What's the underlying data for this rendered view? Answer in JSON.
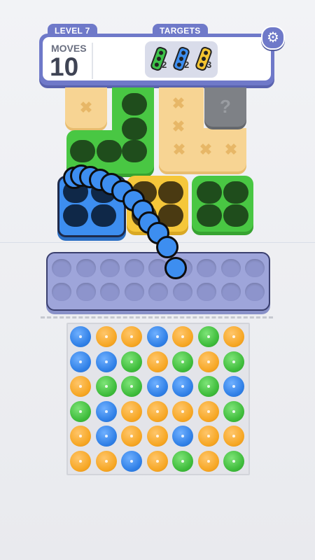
{
  "header": {
    "level": "LEVEL 7",
    "targets_label": "TARGETS",
    "moves_label": "MOVES",
    "moves_value": "10",
    "targets": [
      {
        "color": "#3dc34a",
        "count": "2"
      },
      {
        "color": "#3d8ef0",
        "count": "2"
      },
      {
        "color": "#f4c531",
        "count": "3"
      }
    ]
  },
  "locked_piece_label": "?",
  "colors": {
    "blue": "#3d8ef0",
    "green": "#49c743",
    "yellow": "#f5c73a",
    "orange": "#f6a623",
    "locked_gray": "#7e8186",
    "sand": "#f7d493",
    "tray": "#9ea5da"
  },
  "ball_grid": [
    [
      "blue",
      "orange",
      "orange",
      "blue",
      "orange",
      "green",
      "orange"
    ],
    [
      "blue",
      "blue",
      "green",
      "orange",
      "green",
      "orange",
      "green"
    ],
    [
      "orange",
      "green",
      "green",
      "blue",
      "blue",
      "green",
      "blue"
    ],
    [
      "green",
      "blue",
      "orange",
      "orange",
      "orange",
      "orange",
      "green"
    ],
    [
      "orange",
      "blue",
      "orange",
      "orange",
      "blue",
      "orange",
      "orange"
    ],
    [
      "orange",
      "orange",
      "blue",
      "orange",
      "green",
      "orange",
      "green"
    ]
  ]
}
